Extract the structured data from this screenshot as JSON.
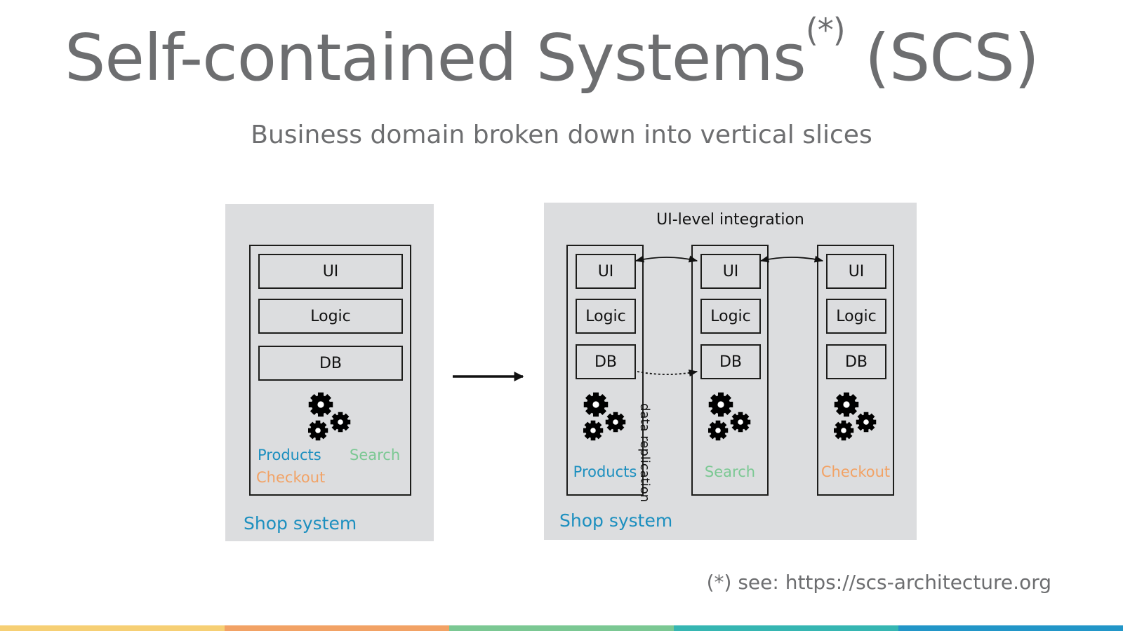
{
  "title": {
    "main": "Self-contained Systems",
    "superscript": "(*)",
    "suffix": " (SCS)"
  },
  "subtitle": "Business domain broken down into vertical slices",
  "left_diagram": {
    "layers": [
      "UI",
      "Logic",
      "DB"
    ],
    "domains": {
      "products": "Products",
      "search": "Search",
      "checkout": "Checkout"
    },
    "label": "Shop system"
  },
  "transition_arrow": "right-arrow",
  "right_diagram": {
    "heading": "UI-level integration",
    "systems": [
      {
        "name": "Products",
        "layers": [
          "UI",
          "Logic",
          "DB"
        ],
        "color": "#1c8fbf"
      },
      {
        "name": "Search",
        "layers": [
          "UI",
          "Logic",
          "DB"
        ],
        "color": "#7bc893"
      },
      {
        "name": "Checkout",
        "layers": [
          "UI",
          "Logic",
          "DB"
        ],
        "color": "#f2a265"
      }
    ],
    "replication_label": "data replication",
    "label": "Shop system"
  },
  "footnote": "(*) see: https://scs-architecture.org",
  "colors": {
    "title": "#6d6e70",
    "panel": "#dcdddf",
    "shop_label": "#1c8fbf",
    "products": "#1c8fbf",
    "search": "#7bc893",
    "checkout": "#f2a265",
    "stripes": [
      "#f6cf74",
      "#f2a265",
      "#7bc893",
      "#36b6b2",
      "#2296c8"
    ]
  }
}
